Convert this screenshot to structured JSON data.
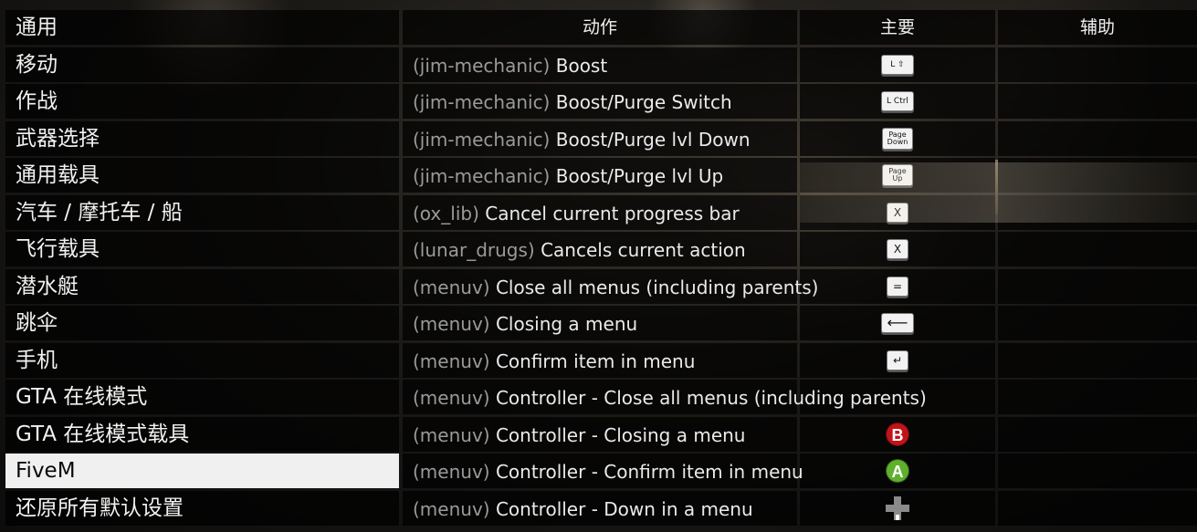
{
  "categories": [
    {
      "label": "通用",
      "selected": false
    },
    {
      "label": "移动",
      "selected": false
    },
    {
      "label": "作战",
      "selected": false
    },
    {
      "label": "武器选择",
      "selected": false
    },
    {
      "label": "通用载具",
      "selected": false
    },
    {
      "label": "汽车 / 摩托车 / 船",
      "selected": false
    },
    {
      "label": "飞行载具",
      "selected": false
    },
    {
      "label": "潜水艇",
      "selected": false
    },
    {
      "label": "跳伞",
      "selected": false
    },
    {
      "label": "手机",
      "selected": false
    },
    {
      "label": "GTA 在线模式",
      "selected": false
    },
    {
      "label": "GTA 在线模式载具",
      "selected": false
    },
    {
      "label": "FiveM",
      "selected": true
    },
    {
      "label": "还原所有默认设置",
      "selected": false
    }
  ],
  "headers": {
    "action": "动作",
    "primary": "主要",
    "secondary": "辅助"
  },
  "bindings": [
    {
      "prefix": "(jim-mechanic)",
      "action": "Boost",
      "primary_key": "L ⇧",
      "key_style": "wide"
    },
    {
      "prefix": "(jim-mechanic)",
      "action": "Boost/Purge Switch",
      "primary_key": "L Ctrl",
      "key_style": "wide"
    },
    {
      "prefix": "(jim-mechanic)",
      "action": "Boost/Purge lvl Down",
      "primary_key": "Page Down",
      "key_style": "med"
    },
    {
      "prefix": "(jim-mechanic)",
      "action": "Boost/Purge lvl Up",
      "primary_key": "Page Up",
      "key_style": "med"
    },
    {
      "prefix": "(ox_lib)",
      "action": "Cancel current progress bar",
      "primary_key": "X",
      "key_style": "sq"
    },
    {
      "prefix": "(lunar_drugs)",
      "action": "Cancels current action",
      "primary_key": "X",
      "key_style": "sq"
    },
    {
      "prefix": "(menuv)",
      "action": "Close all menus (including parents)",
      "primary_key": "=",
      "key_style": "sq"
    },
    {
      "prefix": "(menuv)",
      "action": "Closing a menu",
      "primary_key": "⟵",
      "key_style": "long"
    },
    {
      "prefix": "(menuv)",
      "action": "Confirm item in menu",
      "primary_key": "↵",
      "key_style": "sq"
    },
    {
      "prefix": "(menuv)",
      "action": "Controller - Close all menus (including parents)",
      "primary_key": "",
      "key_style": "none"
    },
    {
      "prefix": "(menuv)",
      "action": "Controller - Closing a menu",
      "primary_key": "B",
      "key_style": "pad-b"
    },
    {
      "prefix": "(menuv)",
      "action": "Controller - Confirm item in menu",
      "primary_key": "A",
      "key_style": "pad-a"
    },
    {
      "prefix": "(menuv)",
      "action": "Controller - Down in a menu",
      "primary_key": "",
      "key_style": "dpad-down"
    }
  ],
  "colors": {
    "pad_b": "#c0141a",
    "pad_a": "#5fb02c",
    "selected_bg": "#f0f0f0"
  }
}
